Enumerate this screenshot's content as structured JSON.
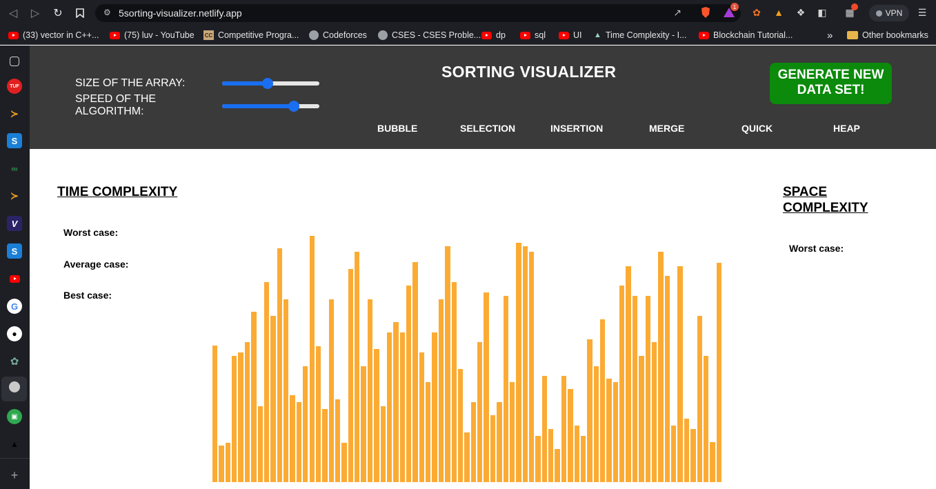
{
  "browser": {
    "url": "5sorting-visualizer.netlify.app",
    "vpn_label": "VPN",
    "notification_count": "1",
    "bookmarks": [
      {
        "label": "(33) vector in C++...",
        "icon": "youtube-icon"
      },
      {
        "label": "(75) luv - YouTube",
        "icon": "youtube-icon"
      },
      {
        "label": "Competitive Progra...",
        "icon": "codechef-icon"
      },
      {
        "label": "Codeforces",
        "icon": "globe-icon"
      },
      {
        "label": "CSES - CSES Proble...",
        "icon": "globe-icon"
      },
      {
        "label": "dp",
        "icon": "youtube-icon"
      },
      {
        "label": "sql",
        "icon": "youtube-icon"
      },
      {
        "label": "UI",
        "icon": "youtube-icon"
      },
      {
        "label": "Time Complexity - I...",
        "icon": "mountain-icon"
      },
      {
        "label": "Blockchain Tutorial...",
        "icon": "youtube-icon"
      }
    ],
    "overflow_label": "»",
    "other_bookmarks": "Other bookmarks"
  },
  "header": {
    "size_label": "SIZE OF THE ARRAY:",
    "speed_label": "SPEED OF THE ALGORITHM:",
    "size_value": 0.47,
    "speed_value": 0.74,
    "title": "SORTING VISUALIZER",
    "generate_label": "GENERATE NEW DATA SET!",
    "algorithms": [
      "BUBBLE",
      "SELECTION",
      "INSERTION",
      "MERGE",
      "QUICK",
      "HEAP"
    ]
  },
  "time_complexity": {
    "heading": "TIME COMPLEXITY",
    "worst": "Worst case:",
    "average": "Average case:",
    "best": "Best case:"
  },
  "space_complexity": {
    "heading": "SPACE COMPLEXITY",
    "worst": "Worst case:"
  },
  "colors": {
    "bar": "#fbab33",
    "header_bg": "#3a3a3a",
    "generate_bg": "#0b8a0b",
    "slider": "#1a6ef0"
  },
  "array_values": [
    198,
    53,
    57,
    183,
    188,
    203,
    247,
    110,
    290,
    241,
    339,
    265,
    126,
    116,
    168,
    357,
    197,
    106,
    265,
    120,
    57,
    309,
    334,
    168,
    265,
    193,
    110,
    217,
    232,
    217,
    285,
    319,
    188,
    145,
    217,
    265,
    342,
    290,
    164,
    72,
    116,
    203,
    275,
    97,
    116,
    270,
    145,
    347,
    342,
    334,
    67,
    154,
    77,
    48,
    154,
    135,
    82,
    67,
    207,
    168,
    236,
    150,
    145,
    285,
    313,
    270,
    183,
    270,
    203,
    334,
    299,
    82,
    313,
    92,
    77,
    241,
    183,
    58,
    318
  ]
}
